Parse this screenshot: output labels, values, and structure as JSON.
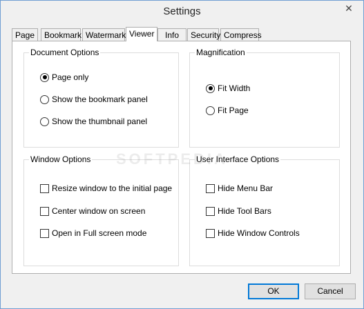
{
  "window": {
    "title": "Settings"
  },
  "tabs": [
    "Page",
    "Bookmark",
    "Watermark",
    "Viewer",
    "Info",
    "Security",
    "Compress"
  ],
  "active_tab": "Viewer",
  "document_options": {
    "label": "Document Options",
    "options": [
      {
        "label": "Page only",
        "checked": true
      },
      {
        "label": "Show the bookmark panel",
        "checked": false
      },
      {
        "label": "Show the thumbnail panel",
        "checked": false
      }
    ]
  },
  "magnification": {
    "label": "Magnification",
    "options": [
      {
        "label": "Fit Width",
        "checked": true
      },
      {
        "label": "Fit Page",
        "checked": false
      }
    ]
  },
  "window_options": {
    "label": "Window Options",
    "options": [
      {
        "label": "Resize window to the initial page",
        "checked": false
      },
      {
        "label": "Center window on screen",
        "checked": false
      },
      {
        "label": "Open in Full screen mode",
        "checked": false
      }
    ]
  },
  "ui_options": {
    "label": "User Interface Options",
    "options": [
      {
        "label": "Hide Menu Bar",
        "checked": false
      },
      {
        "label": "Hide Tool Bars",
        "checked": false
      },
      {
        "label": "Hide Window Controls",
        "checked": false
      }
    ]
  },
  "buttons": {
    "ok": "OK",
    "cancel": "Cancel"
  },
  "watermark_text": "SOFTPEDIA",
  "icons": {
    "close": "close-icon"
  }
}
